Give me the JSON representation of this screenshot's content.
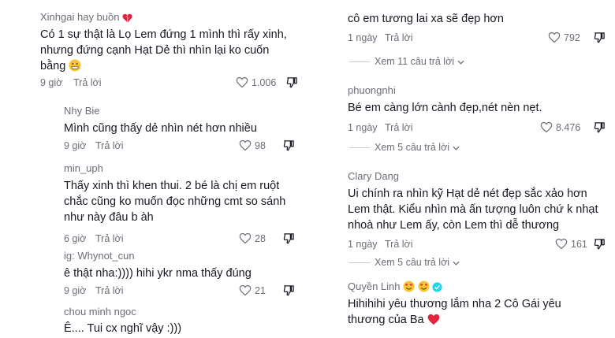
{
  "left": {
    "comments": [
      {
        "name": "Xinhgai hay buồn",
        "text": "Có 1 sự thật là Lọ Lem đứng 1 mình thì rấy xinh, nhưng đứng cạnh Hạt Dẻ thì nhìn lại ko cuốn bằng",
        "time": "9 giờ",
        "reply": "Trả lời",
        "likes": "1.006"
      },
      {
        "name": "Nhy Bie",
        "text": "Mình cũng thấy dẻ nhìn nét hơn nhiều",
        "time": "9 giờ",
        "reply": "Trả lời",
        "likes": "98"
      },
      {
        "name": "min_uph",
        "text": "Thấy xinh thì khen thui. 2 bé là chị em ruột chắc cũng ko muốn đọc những cmt so sánh như này đâu b àh",
        "time": "6 giờ",
        "reply": "Trả lời",
        "likes": "28"
      },
      {
        "name": "ig: Whynot_cun",
        "text": "ê thật nha:)))) hihi ykr nma thấy đúng",
        "time": "9 giờ",
        "reply": "Trả lời",
        "likes": "21"
      },
      {
        "name": "chou minh ngoc",
        "text": "Ê.... Tui cx nghĩ vậy :)))"
      }
    ]
  },
  "right": {
    "top": {
      "text": "cô em tương lai xa sẽ đẹp hơn",
      "time": "1 ngày",
      "reply": "Trả lời",
      "likes": "792"
    },
    "more1": "Xem 11 câu trả lời",
    "c1": {
      "name": "phuongnhi",
      "text": "Bé em càng lớn cành đẹp,nét nèn nẹt.",
      "time": "1 ngày",
      "reply": "Trả lời",
      "likes": "8.476"
    },
    "more2": "Xem 5 câu trả lời",
    "c2": {
      "name": "Clary Dang",
      "text": "Ui chính ra nhìn kỹ Hạt dẻ nét đẹp sắc xảo hơn Lem thật. Kiểu nhìn mà ấn tượng luôn chứ k nhạt nhoà như Lem ấy, còn Lem thì dễ thương",
      "time": "1 ngày",
      "reply": "Trả lời",
      "likes": "161"
    },
    "more3": "Xem 5 câu trả lời",
    "c3": {
      "name": "Quyền Linh",
      "text": "Hihihihi yêu thương lắm nha 2 Cô Gái yêu thương của Ba"
    }
  },
  "colors": {
    "text": "#161823",
    "meta": "#6b6e78",
    "verified": "#20d5ec",
    "heart": "#e1253f"
  }
}
